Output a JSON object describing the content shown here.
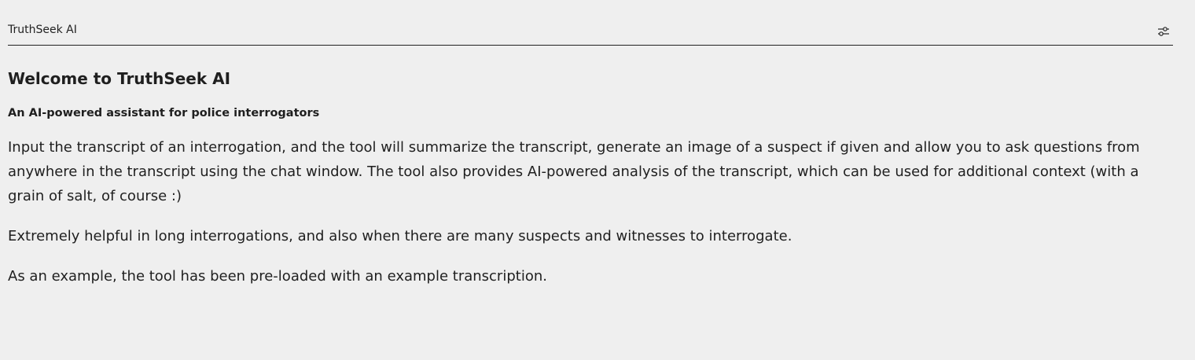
{
  "header": {
    "title": "TruthSeek AI",
    "settings_icon": "sliders-icon"
  },
  "main": {
    "heading": "Welcome to TruthSeek AI",
    "subheading": "An AI-powered assistant for police interrogators",
    "paragraphs": [
      "Input the transcript of an interrogation, and the tool will summarize the transcript, generate an image of a suspect if given and allow you to ask questions from anywhere in the transcript using the chat window. The tool also provides AI-powered analysis of the transcript, which can be used for additional context (with a grain of salt, of course :)",
      "Extremely helpful in long interrogations, and also when there are many suspects and witnesses to interrogate.",
      "As an example, the tool has been pre-loaded with an example transcription."
    ]
  }
}
